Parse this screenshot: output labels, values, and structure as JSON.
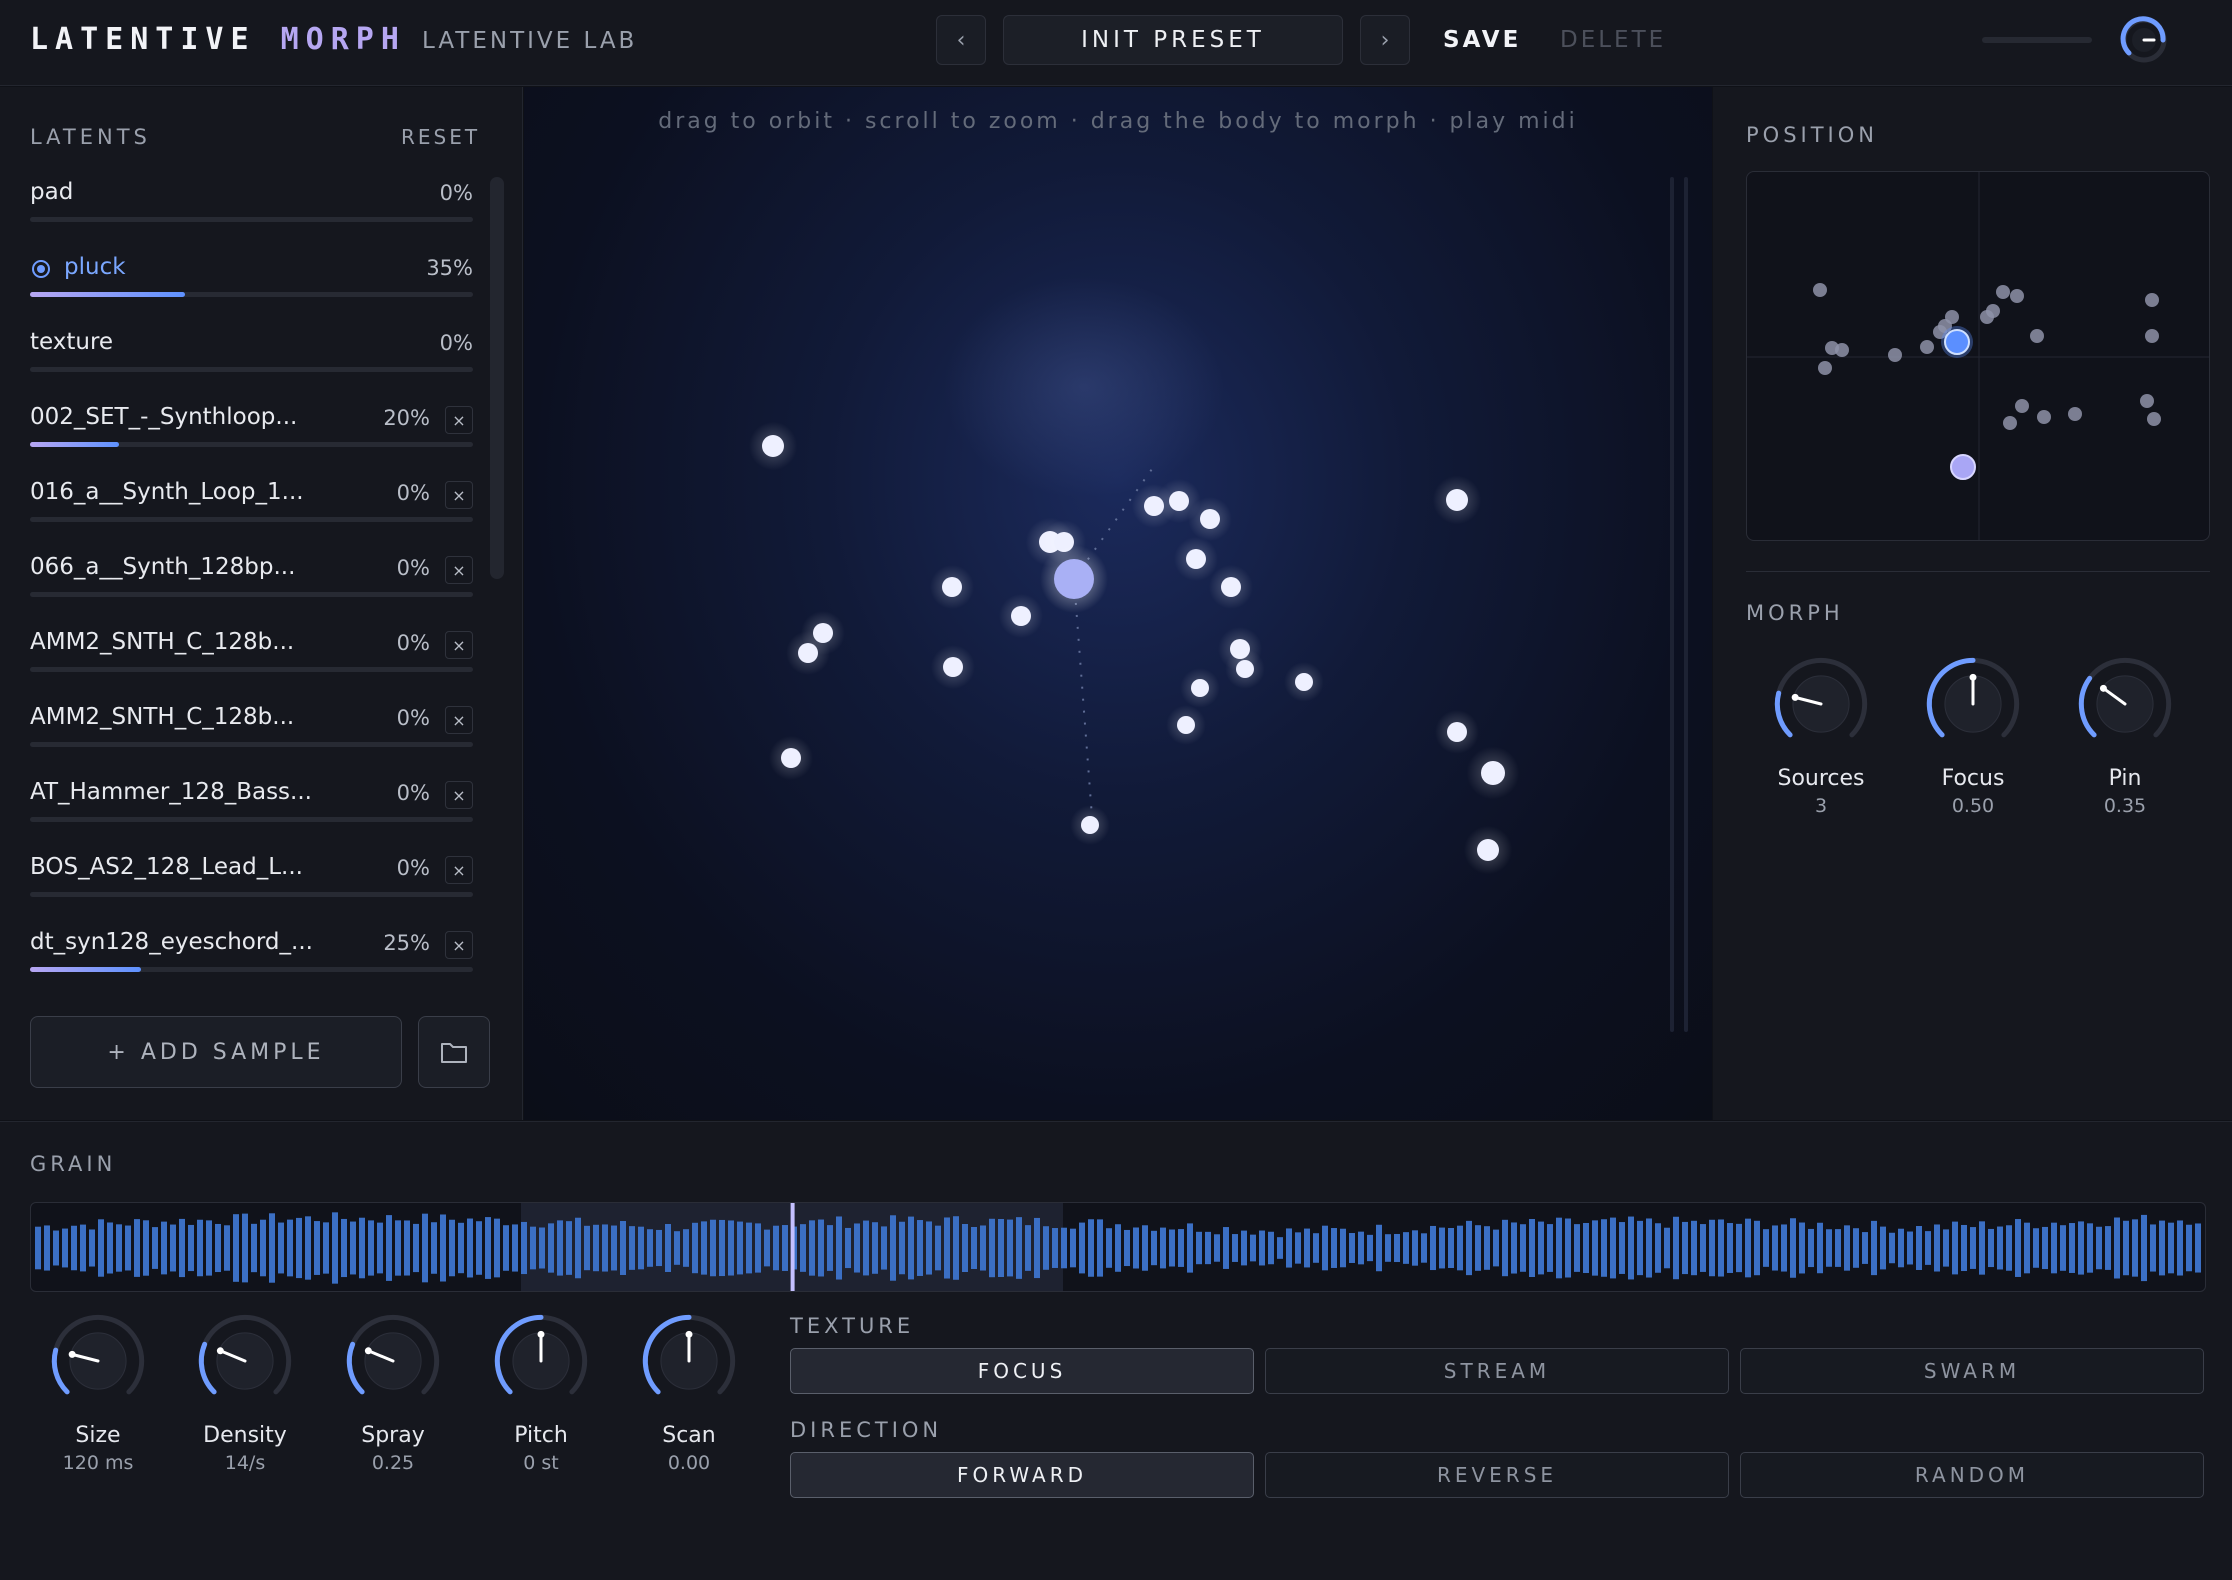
{
  "header": {
    "brand_main": "LATENTIVE",
    "brand_accent": "MORPH",
    "lab": "LATENTIVE LAB",
    "prev_icon": "‹",
    "next_icon": "›",
    "preset": "INIT PRESET",
    "save": "SAVE",
    "delete": "DELETE"
  },
  "latents": {
    "title": "LATENTS",
    "reset": "RESET",
    "items": [
      {
        "name": "pad",
        "pct": "0%",
        "fill": 0,
        "removable": false,
        "active": false
      },
      {
        "name": "pluck",
        "pct": "35%",
        "fill": 0.35,
        "removable": false,
        "active": true
      },
      {
        "name": "texture",
        "pct": "0%",
        "fill": 0,
        "removable": false,
        "active": false
      },
      {
        "name": "002_SET_-_Synthloop...",
        "pct": "20%",
        "fill": 0.2,
        "removable": true,
        "active": false
      },
      {
        "name": "016_a__Synth_Loop_1...",
        "pct": "0%",
        "fill": 0,
        "removable": true,
        "active": false
      },
      {
        "name": "066_a__Synth_128bp...",
        "pct": "0%",
        "fill": 0,
        "removable": true,
        "active": false
      },
      {
        "name": "AMM2_SNTH_C_128b...",
        "pct": "0%",
        "fill": 0,
        "removable": true,
        "active": false
      },
      {
        "name": "AMM2_SNTH_C_128b...",
        "pct": "0%",
        "fill": 0,
        "removable": true,
        "active": false
      },
      {
        "name": "AT_Hammer_128_Bass...",
        "pct": "0%",
        "fill": 0,
        "removable": true,
        "active": false
      },
      {
        "name": "BOS_AS2_128_Lead_L...",
        "pct": "0%",
        "fill": 0,
        "removable": true,
        "active": false
      },
      {
        "name": "dt_syn128_eyeschord_...",
        "pct": "25%",
        "fill": 0.25,
        "removable": true,
        "active": false
      }
    ],
    "remove_icon": "×",
    "add_sample": "+ ADD SAMPLE"
  },
  "viewport": {
    "hint": "drag to orbit · scroll to zoom · drag the body to morph · play midi"
  },
  "position": {
    "title": "POSITION"
  },
  "morph": {
    "title": "MORPH",
    "knobs": [
      {
        "label": "Sources",
        "value": "3",
        "level": 0.22
      },
      {
        "label": "Focus",
        "value": "0.50",
        "level": 0.5
      },
      {
        "label": "Pin",
        "value": "0.35",
        "level": 0.3
      }
    ]
  },
  "grain": {
    "title": "GRAIN",
    "knobs": [
      {
        "label": "Size",
        "value": "120 ms",
        "level": 0.22
      },
      {
        "label": "Density",
        "value": "14/s",
        "level": 0.25
      },
      {
        "label": "Spray",
        "value": "0.25",
        "level": 0.25
      },
      {
        "label": "Pitch",
        "value": "0 st",
        "level": 0.5
      },
      {
        "label": "Scan",
        "value": "0.00",
        "level": 0.5
      }
    ],
    "texture_title": "TEXTURE",
    "texture_options": [
      "FOCUS",
      "STREAM",
      "SWARM"
    ],
    "texture_selected": "FOCUS",
    "direction_title": "DIRECTION",
    "direction_options": [
      "FORWARD",
      "REVERSE",
      "RANDOM"
    ],
    "direction_selected": "FORWARD",
    "playhead": 0.35
  },
  "colors": {
    "accent": "#6f9cff",
    "accent_soft": "#b6a7f2",
    "wave": "#3b6fc4"
  }
}
